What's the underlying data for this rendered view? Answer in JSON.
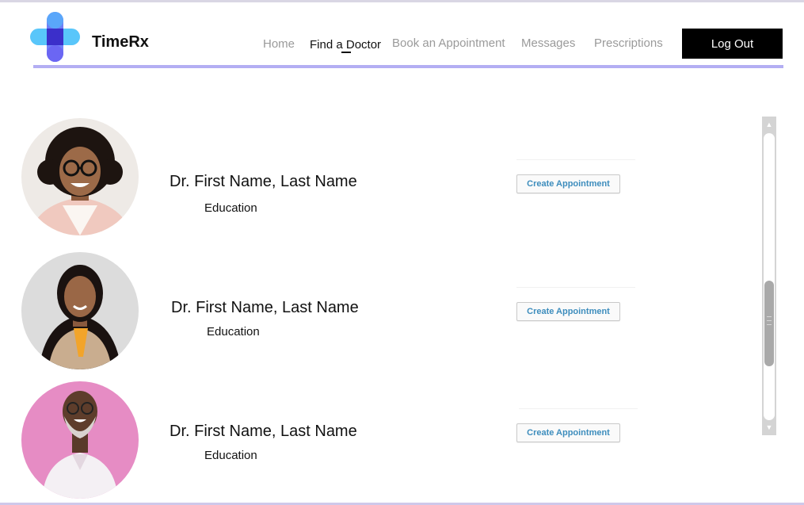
{
  "header": {
    "brand": "TimeRx",
    "nav": [
      {
        "label": "Home",
        "active": false
      },
      {
        "label": "Find a Doctor",
        "active": true
      },
      {
        "label": "Book an Appointment",
        "active": false
      },
      {
        "label": "Messages",
        "active": false
      },
      {
        "label": "Prescriptions",
        "active": false
      }
    ],
    "logout_label": "Log Out"
  },
  "doctors": [
    {
      "name": "Dr. First Name, Last Name",
      "education": "Education",
      "button": "Create Appointment"
    },
    {
      "name": "Dr. First Name, Last Name",
      "education": "Education",
      "button": "Create Appointment"
    },
    {
      "name": "Dr. First Name, Last Name",
      "education": "Education",
      "button": "Create Appointment"
    }
  ],
  "colors": {
    "accent_line": "#b3aef3",
    "logo_light": "#5cc8fb",
    "logo_dark": "#3d2fc7",
    "button_text": "#3d8dbd"
  }
}
